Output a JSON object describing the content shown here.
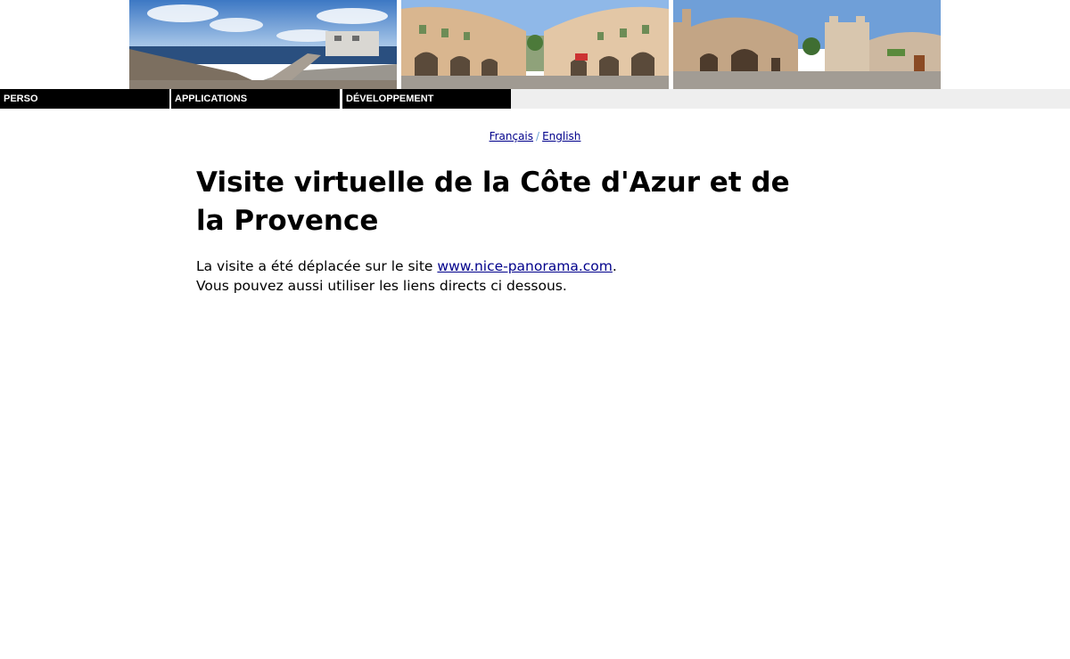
{
  "banner": {
    "images": [
      {
        "name": "panorama-seaside",
        "description_icon": "panorama-image"
      },
      {
        "name": "panorama-arcades",
        "description_icon": "panorama-image"
      },
      {
        "name": "panorama-village",
        "description_icon": "panorama-image"
      }
    ]
  },
  "nav": {
    "items": [
      {
        "label": "PERSO"
      },
      {
        "label": "APPLICATIONS"
      },
      {
        "label": "DÉVELOPPEMENT"
      }
    ],
    "bg_color": "#000000",
    "text_color": "#ffffff",
    "bar_color": "#eeeeee"
  },
  "lang": {
    "french": "Français",
    "separator": "/",
    "english": "English",
    "link_color": "#00008b"
  },
  "main": {
    "title": "Visite virtuelle de la Côte d'Azur et de la Provence",
    "line1_before": "La visite a été déplacée sur le site ",
    "line1_link": "www.nice-panorama.com",
    "line1_after": ".",
    "line2": "Vous pouvez aussi utiliser les liens directs ci dessous."
  }
}
